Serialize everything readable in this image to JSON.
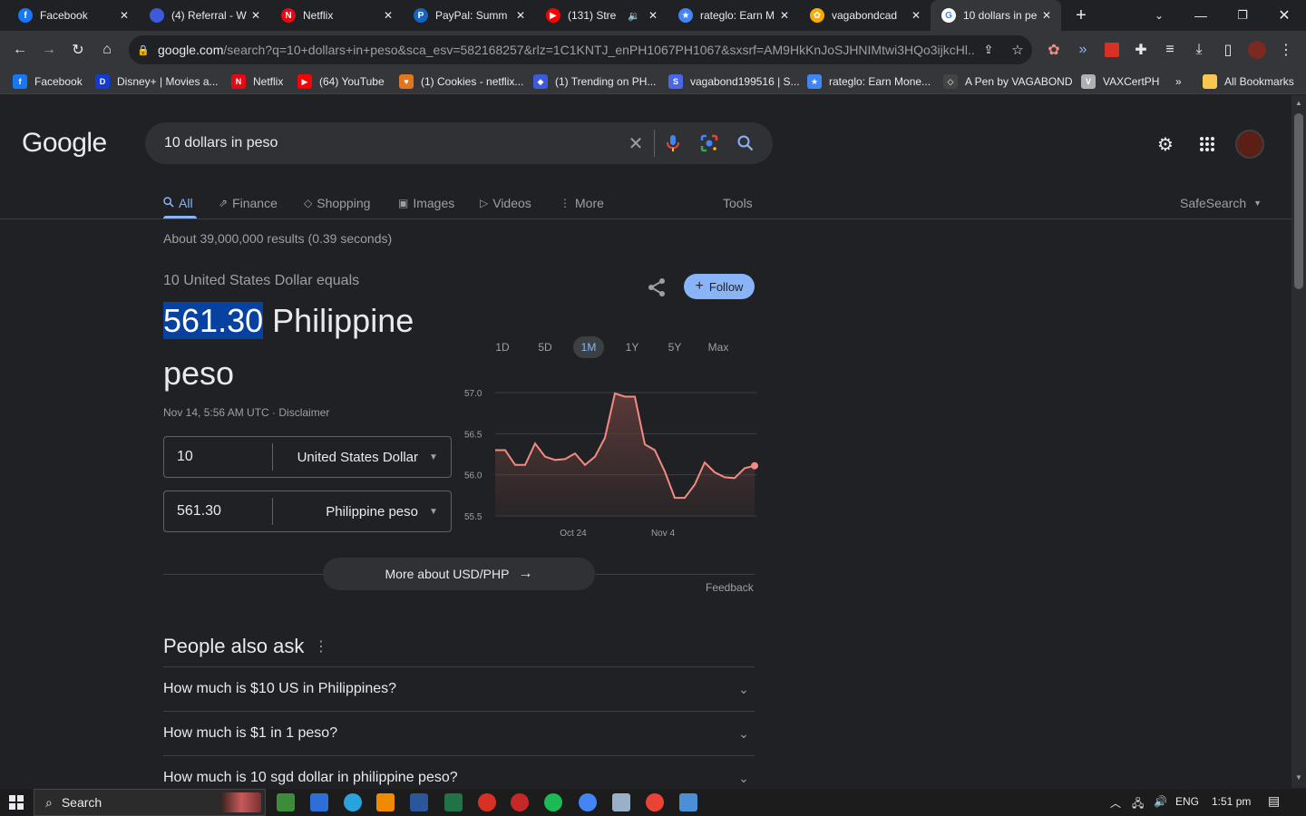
{
  "browser": {
    "tabs": [
      {
        "label": "Facebook",
        "icon": "facebook-icon",
        "color": "#1877f2",
        "glyph": "f"
      },
      {
        "label": "(4) Referral - W",
        "icon": "shield-icon",
        "color": "#3b5bdb",
        "glyph": ""
      },
      {
        "label": "Netflix",
        "icon": "netflix-icon",
        "color": "#e50914",
        "glyph": "N"
      },
      {
        "label": "PayPal: Summ",
        "icon": "paypal-icon",
        "color": "#1565c0",
        "glyph": "P"
      },
      {
        "label": "(131) Stre",
        "icon": "youtube-icon",
        "color": "#ff0000",
        "glyph": "▶"
      },
      {
        "label": "rateglo: Earn M",
        "icon": "star-icon",
        "color": "#4285f4",
        "glyph": "★"
      },
      {
        "label": "vagabondcad",
        "icon": "paw-icon",
        "color": "#f9ab00",
        "glyph": "✿"
      },
      {
        "label": "10 dollars in pe",
        "icon": "google-icon",
        "color": "#ffffff",
        "glyph": "G"
      }
    ],
    "url_domain": "google.com",
    "url_rest": "/search?q=10+dollars+in+peso&sca_esv=582168257&rlz=1C1KNTJ_enPH1067PH1067&sxsrf=AM9HkKnJoSJHNIMtwi3HQo3ijkcHl...",
    "bookmarks": [
      {
        "label": "Facebook",
        "color": "#1877f2",
        "glyph": "f"
      },
      {
        "label": "Disney+ | Movies a...",
        "color": "#113ccf",
        "glyph": "D"
      },
      {
        "label": "Netflix",
        "color": "#e50914",
        "glyph": "N"
      },
      {
        "label": "(64) YouTube",
        "color": "#ff0000",
        "glyph": "▶"
      },
      {
        "label": "(1) Cookies - netflix...",
        "color": "#e0761f",
        "glyph": "♥"
      },
      {
        "label": "(1) Trending on PH...",
        "color": "#3b5bdb",
        "glyph": "◆"
      },
      {
        "label": "vagabond199516 | S...",
        "color": "#4a67e8",
        "glyph": "S"
      },
      {
        "label": "rateglo: Earn Mone...",
        "color": "#4285f4",
        "glyph": "★"
      },
      {
        "label": "A Pen by VAGABOND",
        "color": "#444",
        "glyph": "◇"
      },
      {
        "label": "VAXCertPH",
        "color": "#b0b0b0",
        "glyph": "V"
      },
      {
        "label": "All Bookmarks",
        "color": "#f9c74f",
        "glyph": ""
      }
    ],
    "bookmarks_more": "»"
  },
  "google": {
    "logo": "Google",
    "query": "10 dollars in peso",
    "tabs": [
      {
        "label": "All",
        "icon": "search-icon",
        "glyph": "🔍"
      },
      {
        "label": "Finance",
        "icon": "finance-icon",
        "glyph": "⇗"
      },
      {
        "label": "Shopping",
        "icon": "tag-icon",
        "glyph": "◇"
      },
      {
        "label": "Images",
        "icon": "image-icon",
        "glyph": "▣"
      },
      {
        "label": "Videos",
        "icon": "video-icon",
        "glyph": "▷"
      },
      {
        "label": "More",
        "icon": "more-icon",
        "glyph": "⋮"
      }
    ],
    "tools": "Tools",
    "safesearch": "SafeSearch",
    "results_stats": "About 39,000,000 results (0.39 seconds)"
  },
  "converter": {
    "equals": "10 United States Dollar equals",
    "amount": "561.30",
    "currency_name": "Philippine peso",
    "timestamp": "Nov 14, 5:56 AM UTC · Disclaimer",
    "from_value": "10",
    "from_currency": "United States Dollar",
    "to_value": "561.30",
    "to_currency": "Philippine peso",
    "follow": "Follow",
    "ranges": [
      "1D",
      "5D",
      "1M",
      "1Y",
      "5Y",
      "Max"
    ],
    "active_range": "1M",
    "more": "More about USD/PHP",
    "feedback": "Feedback"
  },
  "chart_data": {
    "type": "area",
    "y_ticks": [
      "57.0",
      "56.5",
      "56.0",
      "55.5"
    ],
    "ylim": [
      55.5,
      57.0
    ],
    "x_ticks": [
      "Oct 24",
      "Nov 4"
    ],
    "values": [
      56.3,
      56.3,
      56.12,
      56.12,
      56.38,
      56.22,
      56.18,
      56.19,
      56.26,
      56.12,
      56.22,
      56.45,
      56.99,
      56.95,
      56.95,
      56.37,
      56.3,
      56.04,
      55.72,
      55.72,
      55.88,
      56.15,
      56.03,
      55.97,
      55.96,
      56.08,
      56.11
    ],
    "line_color": "#f28b82",
    "fill_color": "#5c3b39"
  },
  "paa": {
    "title": "People also ask",
    "questions": [
      "How much is $10 US in Philippines?",
      "How much is $1 in 1 peso?",
      "How much is 10 sgd dollar in philippine peso?"
    ]
  },
  "taskbar": {
    "search": "Search",
    "language": "ENG",
    "time": "1:51 pm"
  }
}
